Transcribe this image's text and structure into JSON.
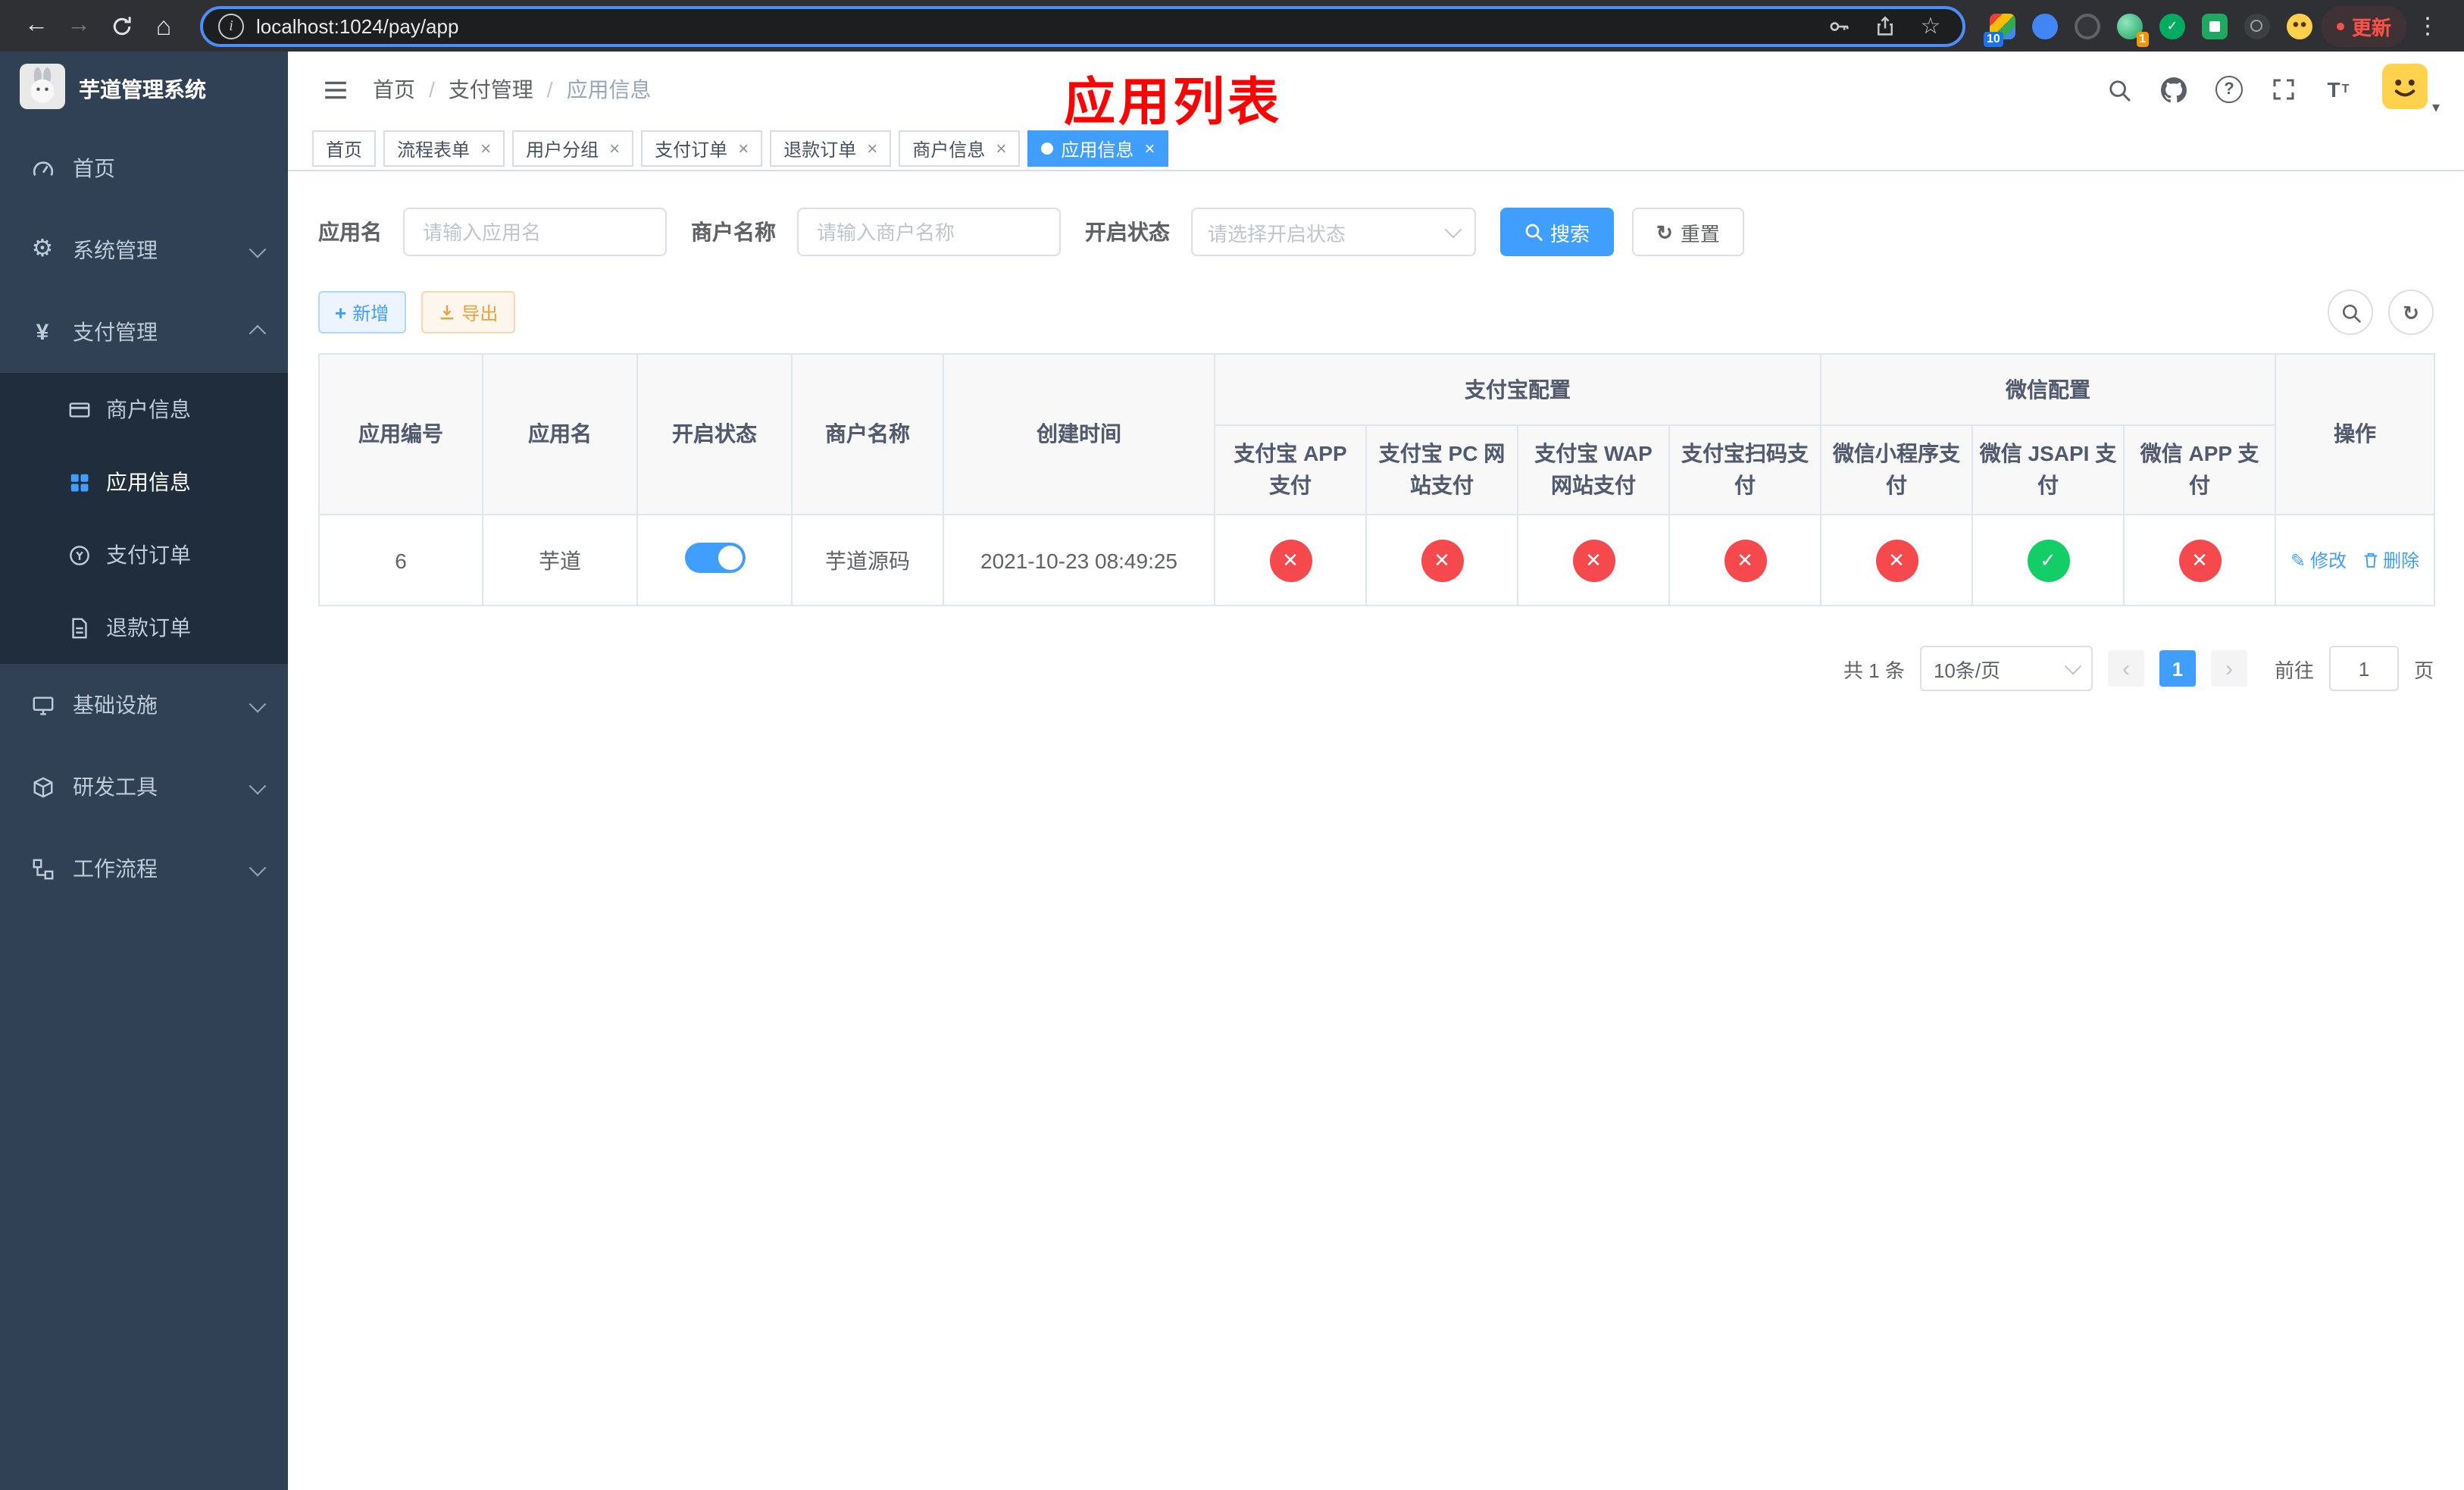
{
  "browser": {
    "url": "localhost:1024/pay/app",
    "update_button": "更新",
    "extension_badge_puzzle": "10",
    "extension_badge_avatar": "1"
  },
  "app": {
    "title": "芋道管理系统",
    "annotation": "应用列表"
  },
  "colors": {
    "accent": "#409eff",
    "danger": "#f5494d",
    "success": "#13ce66",
    "warning": "#e6a23c",
    "sidebar": "#304156",
    "annotation": "#ff0000"
  },
  "sidebar": {
    "items": [
      {
        "label": "首页"
      },
      {
        "label": "系统管理"
      },
      {
        "label": "支付管理"
      },
      {
        "label": "基础设施"
      },
      {
        "label": "研发工具"
      },
      {
        "label": "工作流程"
      }
    ],
    "payment_children": [
      {
        "label": "商户信息"
      },
      {
        "label": "应用信息"
      },
      {
        "label": "支付订单"
      },
      {
        "label": "退款订单"
      }
    ]
  },
  "breadcrumb": {
    "separator": "/",
    "items": [
      "首页",
      "支付管理",
      "应用信息"
    ]
  },
  "tabs": [
    {
      "label": "首页"
    },
    {
      "label": "流程表单"
    },
    {
      "label": "用户分组"
    },
    {
      "label": "支付订单"
    },
    {
      "label": "退款订单"
    },
    {
      "label": "商户信息"
    },
    {
      "label": "应用信息"
    }
  ],
  "filters": {
    "app_name_label": "应用名",
    "app_name_placeholder": "请输入应用名",
    "merchant_label": "商户名称",
    "merchant_placeholder": "请输入商户名称",
    "status_label": "开启状态",
    "status_placeholder": "请选择开启状态",
    "search_button": "搜索",
    "reset_button": "重置"
  },
  "toolbar": {
    "add_button": "新增",
    "export_button": "导出"
  },
  "table": {
    "headers": {
      "app_id": "应用编号",
      "app_name": "应用名",
      "status": "开启状态",
      "merchant": "商户名称",
      "create_time": "创建时间",
      "alipay_group": "支付宝配置",
      "wechat_group": "微信配置",
      "alipay_app": "支付宝 APP 支付",
      "alipay_pc": "支付宝 PC 网站支付",
      "alipay_wap": "支付宝 WAP 网站支付",
      "alipay_qr": "支付宝扫码支付",
      "wx_lite": "微信小程序支付",
      "wx_jsapi": "微信 JSAPI 支付",
      "wx_app": "微信 APP 支付",
      "actions": "操作"
    },
    "rows": [
      {
        "app_id": "6",
        "app_name": "芋道",
        "status": "on",
        "merchant": "芋道源码",
        "create_time": "2021-10-23 08:49:25",
        "channels": {
          "alipay_app": "disabled",
          "alipay_pc": "disabled",
          "alipay_wap": "disabled",
          "alipay_qr": "disabled",
          "wx_lite": "disabled",
          "wx_jsapi": "enabled",
          "wx_app": "disabled"
        },
        "edit_label": "修改",
        "delete_label": "删除"
      }
    ]
  },
  "pagination": {
    "total_text": "共 1 条",
    "page_size": "10条/页",
    "current_page": "1",
    "goto_label": "前往",
    "goto_value": "1",
    "page_suffix": "页"
  }
}
